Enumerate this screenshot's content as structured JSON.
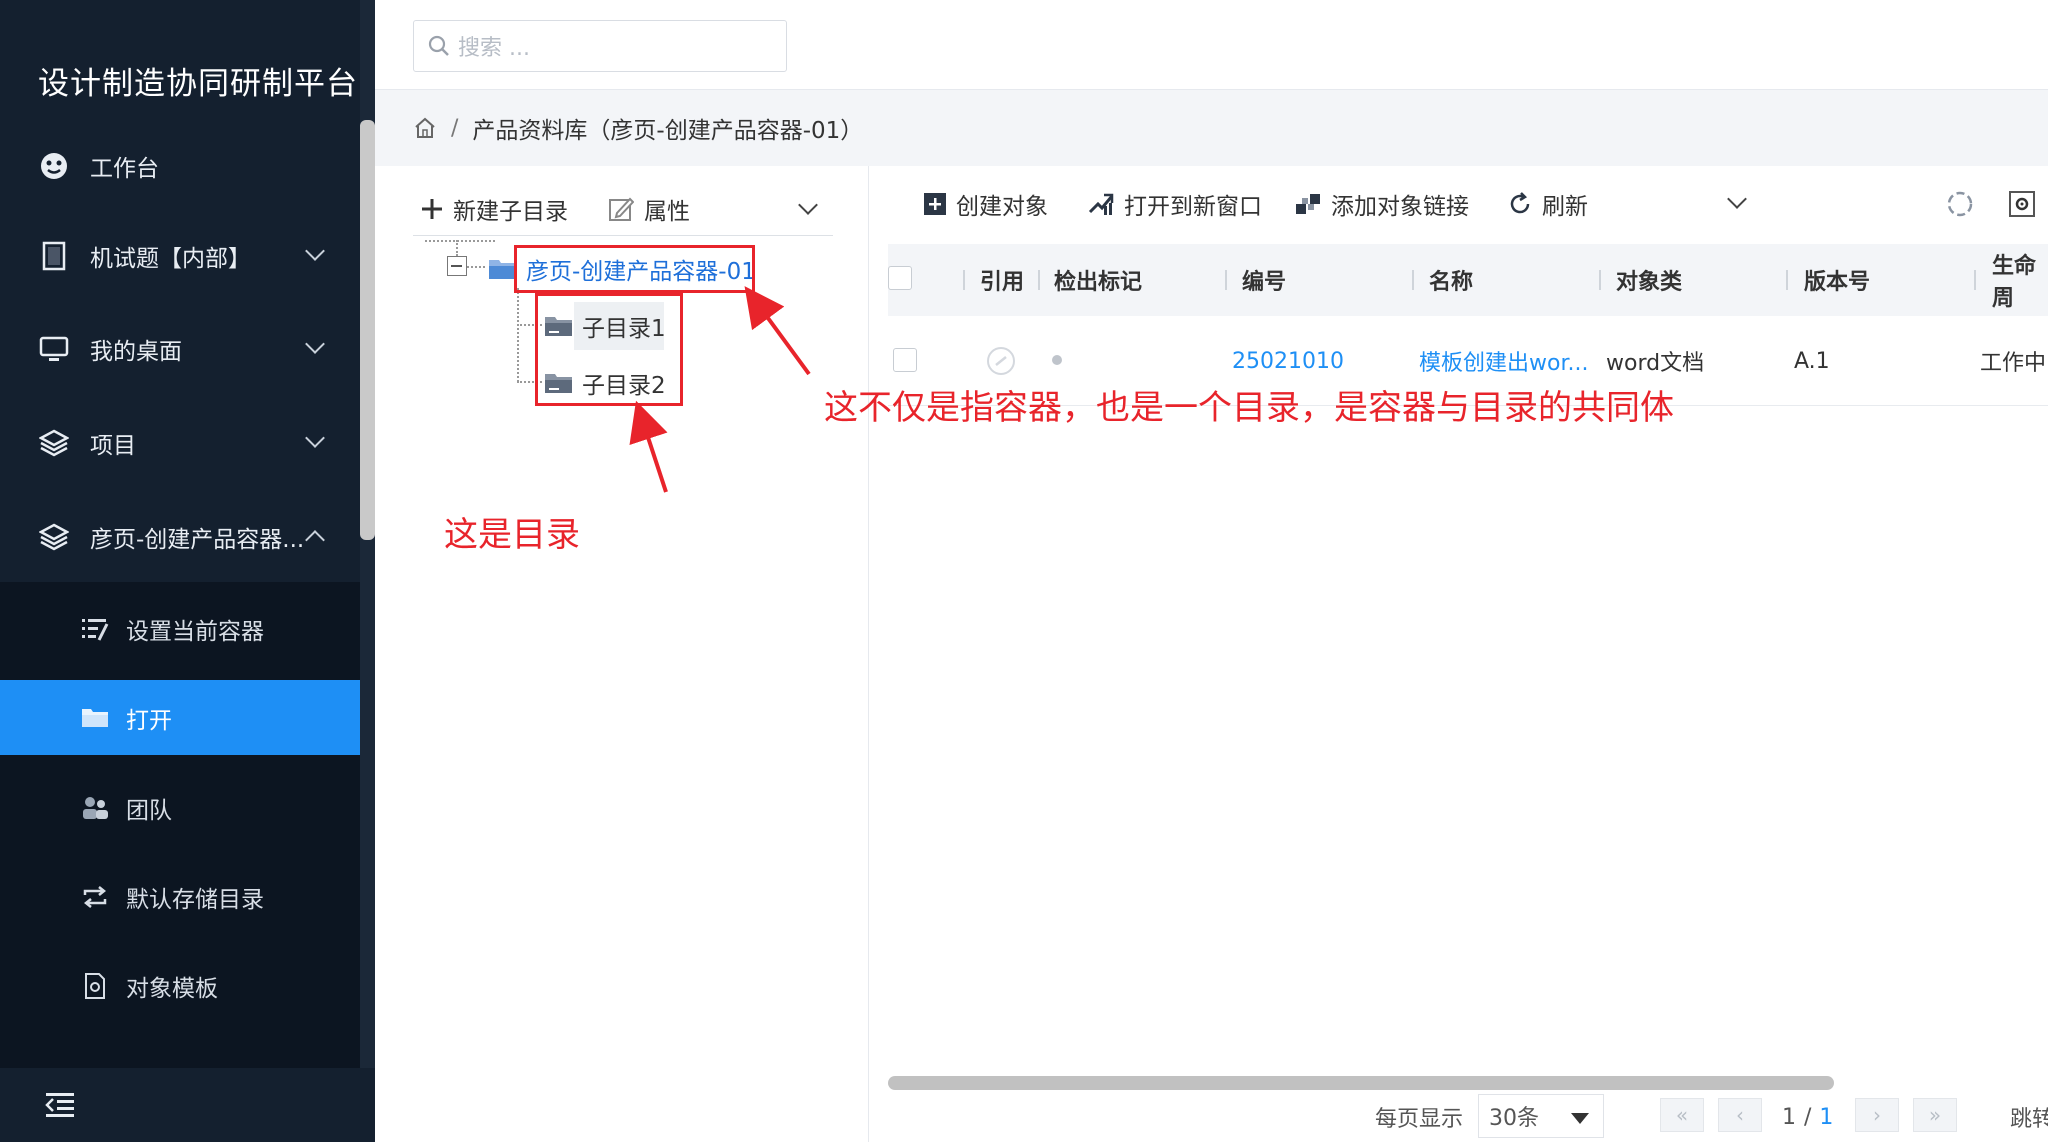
{
  "app": {
    "title": "设计制造协同研制平台"
  },
  "sidebar": {
    "items": [
      {
        "label": "工作台",
        "icon": "dashboard-icon"
      },
      {
        "label": "机试题【内部】",
        "icon": "book-icon"
      },
      {
        "label": "我的桌面",
        "icon": "monitor-icon"
      },
      {
        "label": "项目",
        "icon": "layers-icon"
      },
      {
        "label": "彦页-创建产品容器...",
        "icon": "layers-icon"
      }
    ],
    "submenu": [
      {
        "label": "设置当前容器",
        "icon": "settings-list-icon"
      },
      {
        "label": "打开",
        "icon": "folder-open-icon",
        "active": true
      },
      {
        "label": "团队",
        "icon": "team-icon"
      },
      {
        "label": "默认存储目录",
        "icon": "sync-icon"
      },
      {
        "label": "对象模板",
        "icon": "template-icon"
      }
    ],
    "footer_icon": "collapse-menu-icon"
  },
  "header": {
    "search_placeholder": "搜索 ..."
  },
  "breadcrumb": {
    "home_icon": "home-icon",
    "separator": "/",
    "current": "产品资料库（彦页-创建产品容器-01）"
  },
  "tree": {
    "toolbar": {
      "new_subdir": "新建子目录",
      "properties": "属性"
    },
    "root": "彦页-创建产品容器-01",
    "children": [
      "子目录1",
      "子目录2"
    ]
  },
  "annotations": {
    "container_note": "这不仅是指容器，也是一个目录，是容器与目录的共同体",
    "directory_note": "这是目录",
    "color": "#e8242b"
  },
  "toolbar": {
    "create_object": "创建对象",
    "open_new_window": "打开到新窗口",
    "add_object_link": "添加对象链接",
    "refresh": "刷新"
  },
  "table": {
    "columns": [
      "引用",
      "检出标记",
      "编号",
      "名称",
      "对象类",
      "版本号",
      "生命周"
    ],
    "rows": [
      {
        "number": "25021010",
        "name": "模板创建出wor...",
        "class": "word文档",
        "version": "A.1",
        "lifecycle": "工作中"
      }
    ]
  },
  "pager": {
    "per_page_label": "每页显示",
    "per_page_value": "30条",
    "current_page": "1",
    "page_sep": "/",
    "total_pages": "1",
    "jump_label": "跳转"
  },
  "colors": {
    "sidebar_bg": "#14202f",
    "active": "#1e8ff5",
    "annotation": "#e8242b"
  }
}
